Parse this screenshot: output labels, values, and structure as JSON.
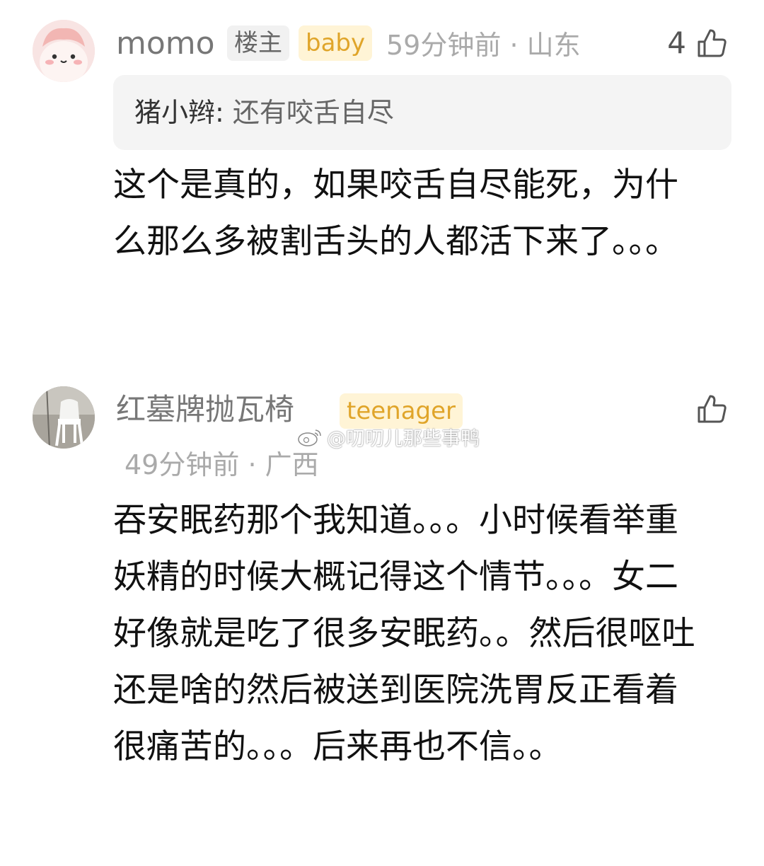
{
  "comments": [
    {
      "username": "momo",
      "badges": [
        "楼主",
        "baby"
      ],
      "time": "59分钟前",
      "location": "山东",
      "likes": "4",
      "quote": {
        "author": "猪小辫: ",
        "text": "还有咬舌自尽"
      },
      "text": "这个是真的，如果咬舌自尽能死，为什么那么多被割舌头的人都活下来了。。。"
    },
    {
      "username": "红墓牌抛瓦椅",
      "badges": [
        "teenager"
      ],
      "time": "49分钟前",
      "location": "广西",
      "likes": "",
      "text": "吞安眠药那个我知道。。。小时候看举重妖精的时候大概记得这个情节。。。女二好像就是吃了很多安眠药。。然后很呕吐还是啥的然后被送到医院洗胃反正看着很痛苦的。。。后来再也不信。。"
    }
  ],
  "watermark": "@叨叨儿那些事鸭",
  "icons": {
    "like": "thumbs-up-icon",
    "weibo": "weibo-logo-icon"
  }
}
